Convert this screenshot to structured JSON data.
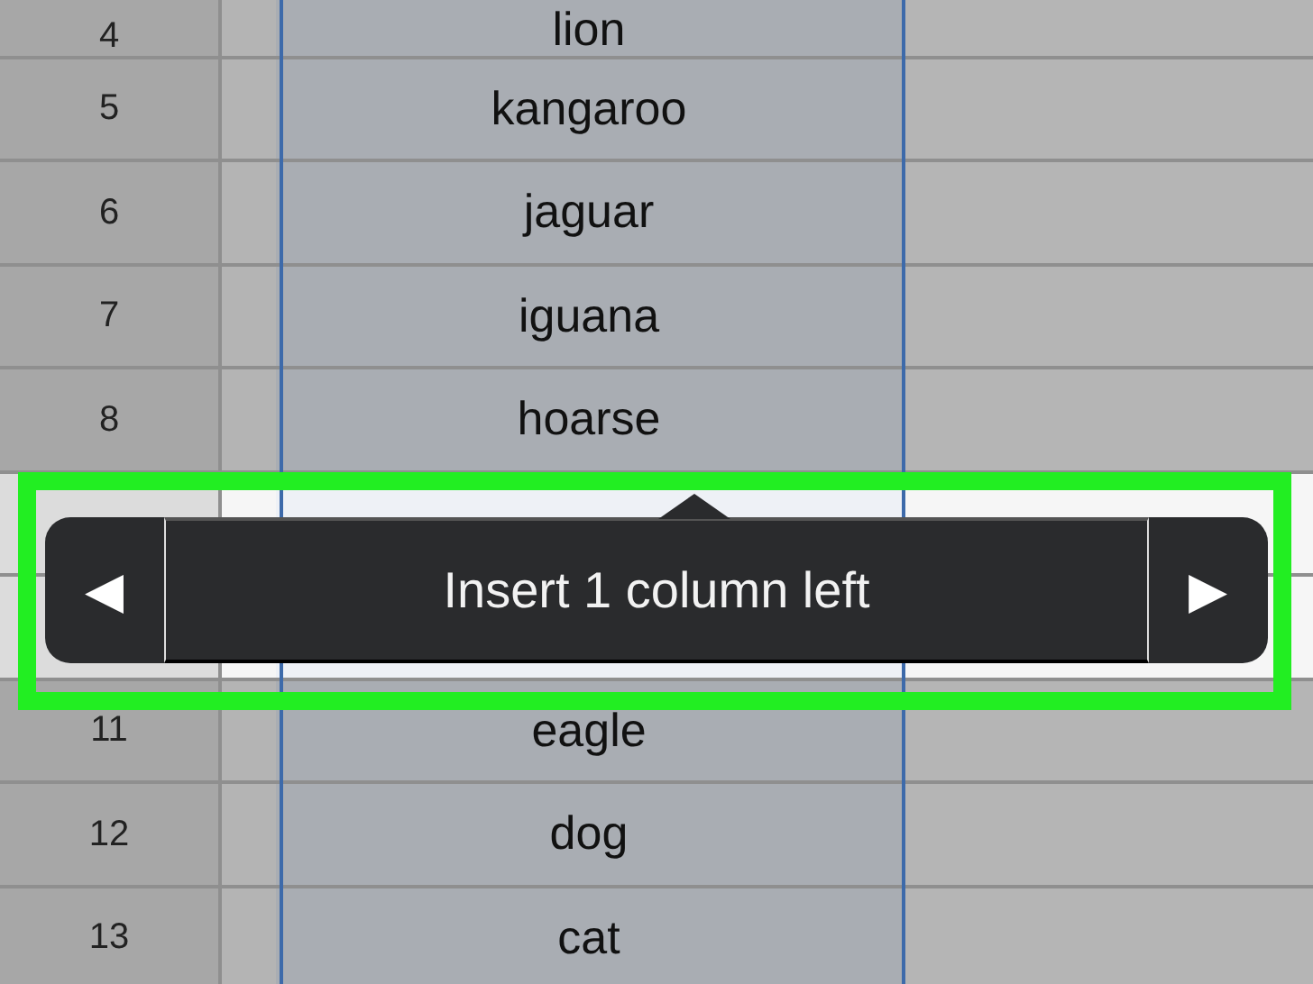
{
  "value_column_selected": true,
  "rows": [
    {
      "header": "4",
      "value": "lion",
      "highlighted": false
    },
    {
      "header": "5",
      "value": "kangaroo",
      "highlighted": false
    },
    {
      "header": "6",
      "value": "jaguar",
      "highlighted": false
    },
    {
      "header": "7",
      "value": "iguana",
      "highlighted": false
    },
    {
      "header": "8",
      "value": "hoarse",
      "highlighted": false
    },
    {
      "highlighted": true
    },
    {
      "highlighted": true
    },
    {
      "header": "11",
      "value": "eagle",
      "highlighted": false
    },
    {
      "header": "12",
      "value": "dog",
      "highlighted": false
    },
    {
      "header": "13",
      "value": "cat",
      "highlighted": false
    }
  ],
  "popup": {
    "prev": "◀",
    "label": "Insert 1 column left",
    "next": "▶"
  }
}
